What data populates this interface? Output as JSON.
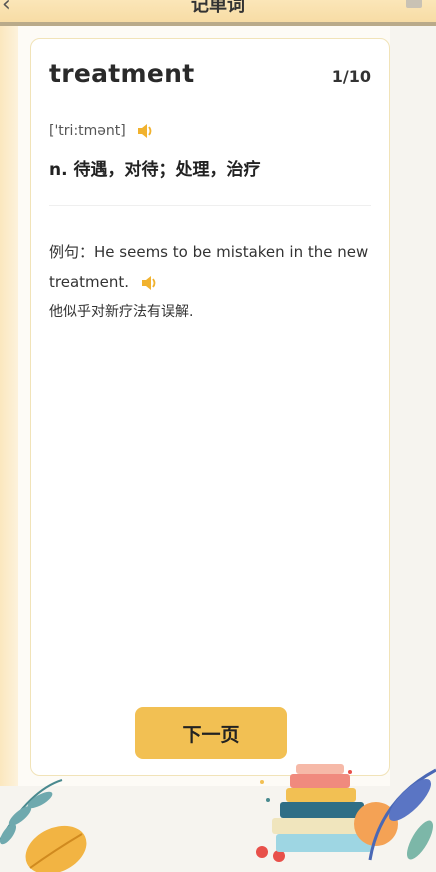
{
  "header": {
    "back_icon": "chevron-left-icon",
    "title": "记单词",
    "bookmark_icon": "bookmark-icon"
  },
  "word_card": {
    "word": "treatment",
    "counter": "1/10",
    "phonetic": "['tri:tmənt]",
    "meaning": "n. 待遇，对待；处理，治疗",
    "example_prefix": "例句：",
    "example_sentence": "He seems to be mistaken in the new treatment.",
    "translation": "他似乎对新疗法有误解."
  },
  "actions": {
    "next_label": "下一页"
  },
  "colors": {
    "accent": "#f2c053",
    "speaker": "#f1b22e",
    "card_border": "#f1e3b8"
  }
}
